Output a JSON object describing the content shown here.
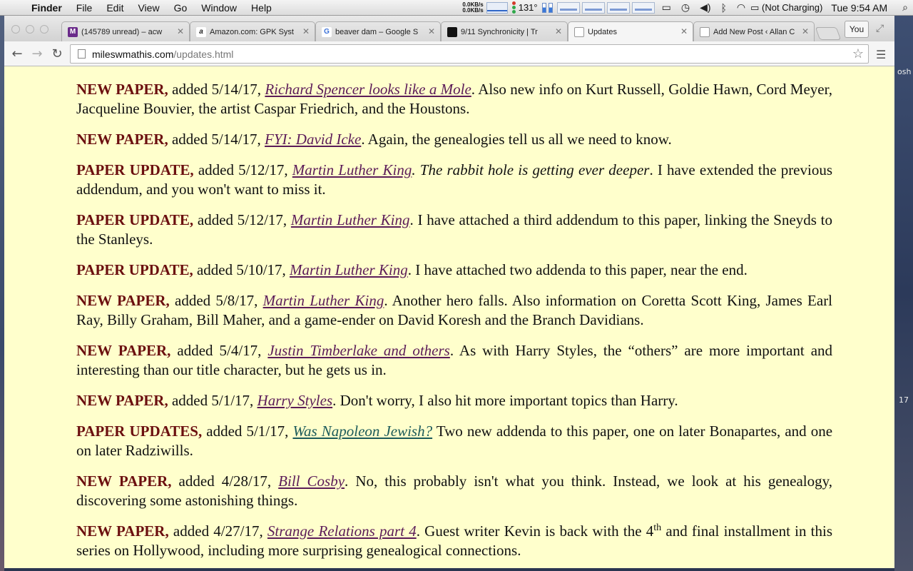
{
  "menubar": {
    "app": "Finder",
    "items": [
      "File",
      "Edit",
      "View",
      "Go",
      "Window",
      "Help"
    ],
    "net_up": "0.0KB/s",
    "net_down": "0.0KB/s",
    "temp": "131°",
    "battery": "(Not Charging)",
    "clock": "Tue 9:54 AM"
  },
  "tabs": [
    {
      "title": "(145789 unread) – acw",
      "favicon": "M",
      "color": "#c23b2b",
      "active": false
    },
    {
      "title": "Amazon.com: GPK Syst",
      "favicon": "a",
      "color": "#222222",
      "active": false
    },
    {
      "title": "beaver dam – Google S",
      "favicon": "G",
      "color": "#3a70d8",
      "active": false
    },
    {
      "title": "9/11 Synchronicity | Tr",
      "favicon": "",
      "color": "#111111",
      "active": false
    },
    {
      "title": "Updates",
      "favicon": "",
      "color": "#ffffff",
      "active": true
    },
    {
      "title": "Add New Post ‹ Allan C",
      "favicon": "",
      "color": "#ffffff",
      "active": false
    }
  ],
  "profile": "You",
  "address": {
    "domain": "mileswmathis.com",
    "path": "/updates.html"
  },
  "entries": [
    {
      "kind": "NEW PAPER,",
      "added": "added 5/14/17,",
      "link": "Richard Spencer looks like a Mole",
      "rest": ". Also new info on Kurt Russell, Goldie Hawn, Cord Meyer, Jacqueline Bouvier, the artist Caspar Friedrich, and the Houstons."
    },
    {
      "kind": "NEW PAPER,",
      "added": "added 5/14/17,",
      "link": "FYI: David Icke",
      "rest": ". Again, the genealogies tell us all we need to know."
    },
    {
      "kind": "PAPER UPDATE,",
      "added": "added 5/12/17,",
      "link": "Martin Luther King",
      "em": ". The rabbit hole is getting ever deeper",
      "rest": ". I have extended the previous addendum, and you won't want to miss it."
    },
    {
      "kind": "PAPER UPDATE,",
      "added": "added 5/12/17,",
      "link": "Martin Luther King",
      "rest": ". I have attached a third addendum to this paper, linking the Sneyds to the Stanleys."
    },
    {
      "kind": "PAPER UPDATE,",
      "added": "added 5/10/17,",
      "link": "Martin Luther King",
      "rest": ". I have attached two addenda to this paper, near the end."
    },
    {
      "kind": "NEW PAPER,",
      "added": "added 5/8/17,",
      "link": "Martin Luther King",
      "rest": ". Another hero falls. Also information on Coretta Scott King, James Earl Ray, Billy Graham, Bill Maher, and a game-ender on David Koresh and the Branch Davidians."
    },
    {
      "kind": "NEW PAPER,",
      "added": "added 5/4/17,",
      "link": "Justin Timberlake and others",
      "rest": ". As with Harry Styles, the “others” are more important and interesting than our title character, but he gets us in."
    },
    {
      "kind": "NEW PAPER,",
      "added": "added 5/1/17,",
      "link": "Harry Styles",
      "rest": ". Don't worry, I also hit more important topics than Harry."
    },
    {
      "kind": "PAPER UPDATES,",
      "added": "added 5/1/17,",
      "link": "Was Napoleon Jewish?",
      "teal": true,
      "rest": " Two new addenda to this paper, one on later Bonapartes, and one on later Radziwills."
    },
    {
      "kind": "NEW PAPER,",
      "added": "added 4/28/17,",
      "link": "Bill Cosby",
      "rest": ". No, this probably isn't what you think. Instead, we look at his genealogy, discovering some astonishing things."
    },
    {
      "kind": "NEW PAPER,",
      "added": "added 4/27/17,",
      "link": "Strange Relations part 4",
      "rest": ". Guest writer Kevin is back with the 4",
      "sup": "th",
      "rest2": " and final installment in this series on Hollywood, including more surprising genealogical connections."
    }
  ],
  "desktop_fragments": [
    "osh",
    "17"
  ]
}
